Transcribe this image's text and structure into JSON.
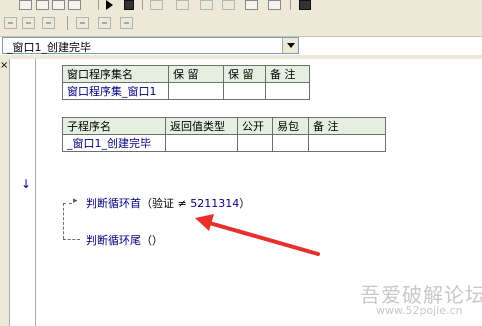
{
  "combo": {
    "value": "_窗口1_创建完毕"
  },
  "left_panel": {
    "close_glyph": "×"
  },
  "table1": {
    "headers": [
      "窗口程序集名",
      "保 留",
      "保 留",
      "备 注"
    ],
    "row": [
      "窗口程序集_窗口1",
      "",
      "",
      ""
    ]
  },
  "table2": {
    "headers": [
      "子程序名",
      "返回值类型",
      "公开",
      "易包",
      "备 注"
    ],
    "row": [
      "_窗口1_创建完毕",
      "",
      "",
      "",
      ""
    ]
  },
  "code": {
    "line1_keyword": "判断循环首",
    "line1_cond_open": "（验证 ≠ ",
    "line1_number": "5211314",
    "line1_cond_close": "）",
    "line2_keyword": "判断循环尾",
    "line2_args": "（）",
    "arrow_glyph": "▸",
    "gutter_arrow": "↓"
  },
  "annotation": {
    "color": "#e8302a"
  },
  "watermark": {
    "title": "吾爱破解论坛",
    "url": "www.52pojie.cn"
  }
}
